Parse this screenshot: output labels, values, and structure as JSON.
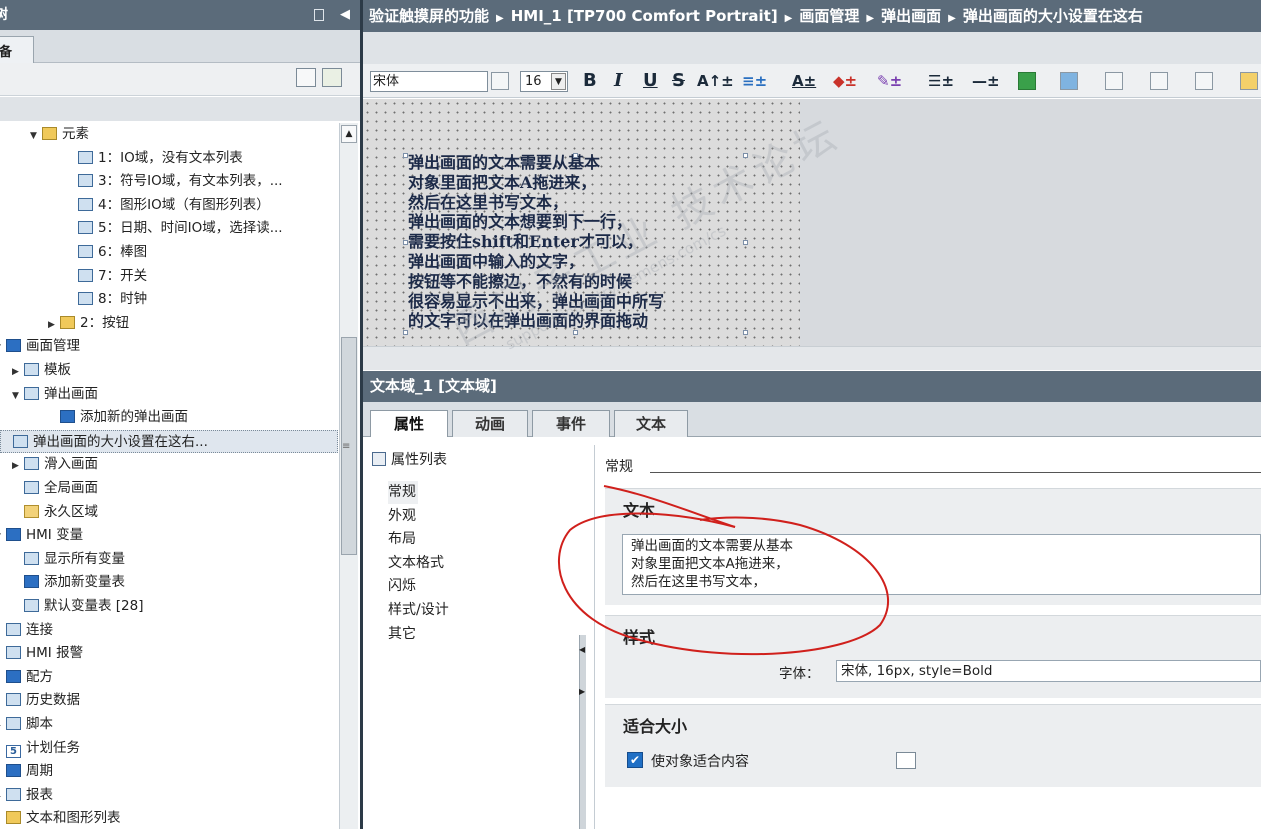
{
  "left_panel": {
    "title": "树",
    "collapse_glyph": "◀",
    "tab_label": "备",
    "tree": [
      {
        "label": "元素",
        "indent": 2,
        "twisty": "▼",
        "icon": "elem"
      },
      {
        "label": "1：IO域，没有文本列表",
        "indent": 4,
        "twisty": "",
        "icon": "scr"
      },
      {
        "label": "3：符号IO域，有文本列表，...",
        "indent": 4,
        "twisty": "",
        "icon": "scr"
      },
      {
        "label": "4：图形IO域（有图形列表）",
        "indent": 4,
        "twisty": "",
        "icon": "scr"
      },
      {
        "label": "5：日期、时间IO域，选择读...",
        "indent": 4,
        "twisty": "",
        "icon": "scr"
      },
      {
        "label": "6：棒图",
        "indent": 4,
        "twisty": "",
        "icon": "scr"
      },
      {
        "label": "7：开关",
        "indent": 4,
        "twisty": "",
        "icon": "scr"
      },
      {
        "label": "8：时钟",
        "indent": 4,
        "twisty": "",
        "icon": "scr"
      },
      {
        "label": "2：按钮",
        "indent": 3,
        "twisty": "▶",
        "icon": "elem"
      },
      {
        "label": "画面管理",
        "indent": 0,
        "twisty": "▼",
        "icon": "blue"
      },
      {
        "label": "模板",
        "indent": 1,
        "twisty": "▶",
        "icon": "scr"
      },
      {
        "label": "弹出画面",
        "indent": 1,
        "twisty": "▼",
        "icon": "scr"
      },
      {
        "label": "添加新的弹出画面",
        "indent": 3,
        "twisty": "",
        "icon": "blue"
      },
      {
        "label": "弹出画面的大小设置在这右...",
        "indent": 3,
        "twisty": "",
        "icon": "scr",
        "selected": true
      },
      {
        "label": "滑入画面",
        "indent": 1,
        "twisty": "▶",
        "icon": "scr"
      },
      {
        "label": "全局画面",
        "indent": 1,
        "twisty": "",
        "icon": "scr"
      },
      {
        "label": "永久区域",
        "indent": 1,
        "twisty": "",
        "icon": "fold"
      },
      {
        "label": "HMI 变量",
        "indent": 0,
        "twisty": "▼",
        "icon": "blue"
      },
      {
        "label": "显示所有变量",
        "indent": 1,
        "twisty": "",
        "icon": "scr"
      },
      {
        "label": "添加新变量表",
        "indent": 1,
        "twisty": "",
        "icon": "blue"
      },
      {
        "label": "默认变量表 [28]",
        "indent": 1,
        "twisty": "",
        "icon": "scr"
      },
      {
        "label": "连接",
        "indent": 0,
        "twisty": "",
        "icon": "scr"
      },
      {
        "label": "HMI 报警",
        "indent": 0,
        "twisty": "",
        "icon": "scr"
      },
      {
        "label": "配方",
        "indent": 0,
        "twisty": "",
        "icon": "blue"
      },
      {
        "label": "历史数据",
        "indent": 0,
        "twisty": "",
        "icon": "scr"
      },
      {
        "label": "脚本",
        "indent": 0,
        "twisty": "▶",
        "icon": "scr"
      },
      {
        "label": "计划任务",
        "indent": 0,
        "twisty": "",
        "icon": "num",
        "glyph": "5"
      },
      {
        "label": "周期",
        "indent": 0,
        "twisty": "",
        "icon": "blue"
      },
      {
        "label": "报表",
        "indent": 0,
        "twisty": "▶",
        "icon": "scr"
      },
      {
        "label": "文本和图形列表",
        "indent": 0,
        "twisty": "",
        "icon": "elem"
      }
    ]
  },
  "breadcrumb": {
    "items": [
      "验证触摸屏的功能",
      "HMI_1 [TP700 Comfort Portrait]",
      "画面管理",
      "弹出画面",
      "弹出画面的大小设置在这右"
    ],
    "separator": "▶"
  },
  "format_toolbar": {
    "font_name": "宋体",
    "font_size": "16",
    "bold": "B",
    "italic": "I",
    "underline": "U",
    "strike": "S",
    "font_grow": "A↑±",
    "align": "≡±",
    "font_color": "A±",
    "fill_color": "◆±",
    "line_color": "✎±",
    "line_style": "☰±",
    "line_width": "—±"
  },
  "canvas": {
    "text": "弹出画面的文本需要从基本\n对象里面把文本A拖进来，\n然后在这里书写文本，\n弹出画面的文本想要到下一行，\n需要按住shift和Enter才可以，\n弹出画面中输入的文字，\n按钮等不能擦边，不然有的时候\n很容易显示不出来，弹出画面中所写\n的文字可以在弹出画面的界面拖动"
  },
  "inspector": {
    "title": "文本域_1 [文本域]",
    "tabs": [
      "属性",
      "动画",
      "事件",
      "文本"
    ],
    "property_list_label": "属性列表",
    "categories": [
      "常规",
      "外观",
      "布局",
      "文本格式",
      "闪烁",
      "样式/设计",
      "其它"
    ],
    "section_title": "常规",
    "text_group": {
      "heading": "文本",
      "value": "弹出画面的文本需要从基本\n对象里面把文本A拖进来，\n然后在这里书写文本，"
    },
    "style_group": {
      "heading": "样式",
      "font_label": "字体：",
      "font_value": "宋体, 16px, style=Bold"
    },
    "fit_group": {
      "heading": "适合大小",
      "checkbox_label": "使对象适合内容",
      "checked": true,
      "check_glyph": "✔"
    }
  },
  "watermark": {
    "line1": "西门子工业  技术论坛",
    "line2": "support.industry.siemens.com/cs"
  },
  "colors": {
    "title_bar": "#5b6b7a",
    "annotation": "#d0201c",
    "selection": "#dfe6ee"
  }
}
